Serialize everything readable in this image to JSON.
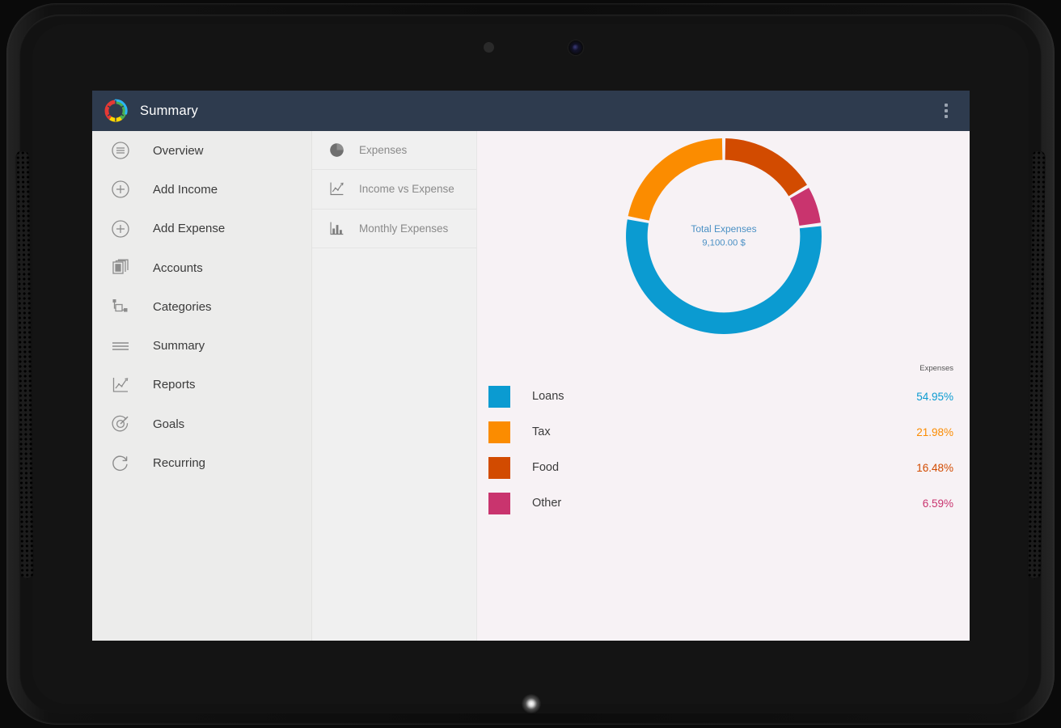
{
  "app_bar": {
    "title": "Summary",
    "logo_icon": "app-donut-logo-icon",
    "overflow_icon": "overflow-menu-icon"
  },
  "sidebar": {
    "items": [
      {
        "label": "Overview",
        "icon": "hamburger-circle-icon"
      },
      {
        "label": "Add Income",
        "icon": "plus-circle-icon"
      },
      {
        "label": "Add Expense",
        "icon": "plus-circle-icon"
      },
      {
        "label": "Accounts",
        "icon": "stacked-cards-icon"
      },
      {
        "label": "Categories",
        "icon": "categories-tree-icon"
      },
      {
        "label": "Summary",
        "icon": "lines-list-icon"
      },
      {
        "label": "Reports",
        "icon": "line-chart-icon"
      },
      {
        "label": "Goals",
        "icon": "target-icon"
      },
      {
        "label": "Recurring",
        "icon": "refresh-circular-icon"
      }
    ]
  },
  "report_list": {
    "items": [
      {
        "label": "Expenses",
        "icon": "pie-chart-icon"
      },
      {
        "label": "Income vs Expense",
        "icon": "line-chart-icon"
      },
      {
        "label": "Monthly Expenses",
        "icon": "bar-chart-icon"
      }
    ]
  },
  "chart_data": {
    "type": "pie",
    "title": "Expenses",
    "center_title": "Total Expenses",
    "center_value": "9,100.00 $",
    "legend_header": "Expenses",
    "legend_position": "bottom",
    "categories": [
      "Loans",
      "Tax",
      "Food",
      "Other"
    ],
    "values": [
      54.95,
      21.98,
      16.48,
      6.59
    ],
    "value_labels": [
      "54.95%",
      "21.98%",
      "16.48%",
      "6.59%"
    ],
    "colors": [
      "#0b9bd1",
      "#fb8c00",
      "#d24b00",
      "#c9346e"
    ],
    "slice_order": [
      "Food",
      "Other",
      "Loans",
      "Tax"
    ],
    "start_angle_deg": 0,
    "inner_radius_ratio": 0.78
  },
  "colors": {
    "app_bar": "#2e3b4e",
    "sidebar_bg": "#ececeb",
    "report_list_bg": "#f0f0f0",
    "content_bg": "#f7f2f5",
    "center_text": "#4a90c4",
    "loans": "#0b9bd1",
    "tax": "#fb8c00",
    "food": "#d24b00",
    "other": "#c9346e"
  }
}
